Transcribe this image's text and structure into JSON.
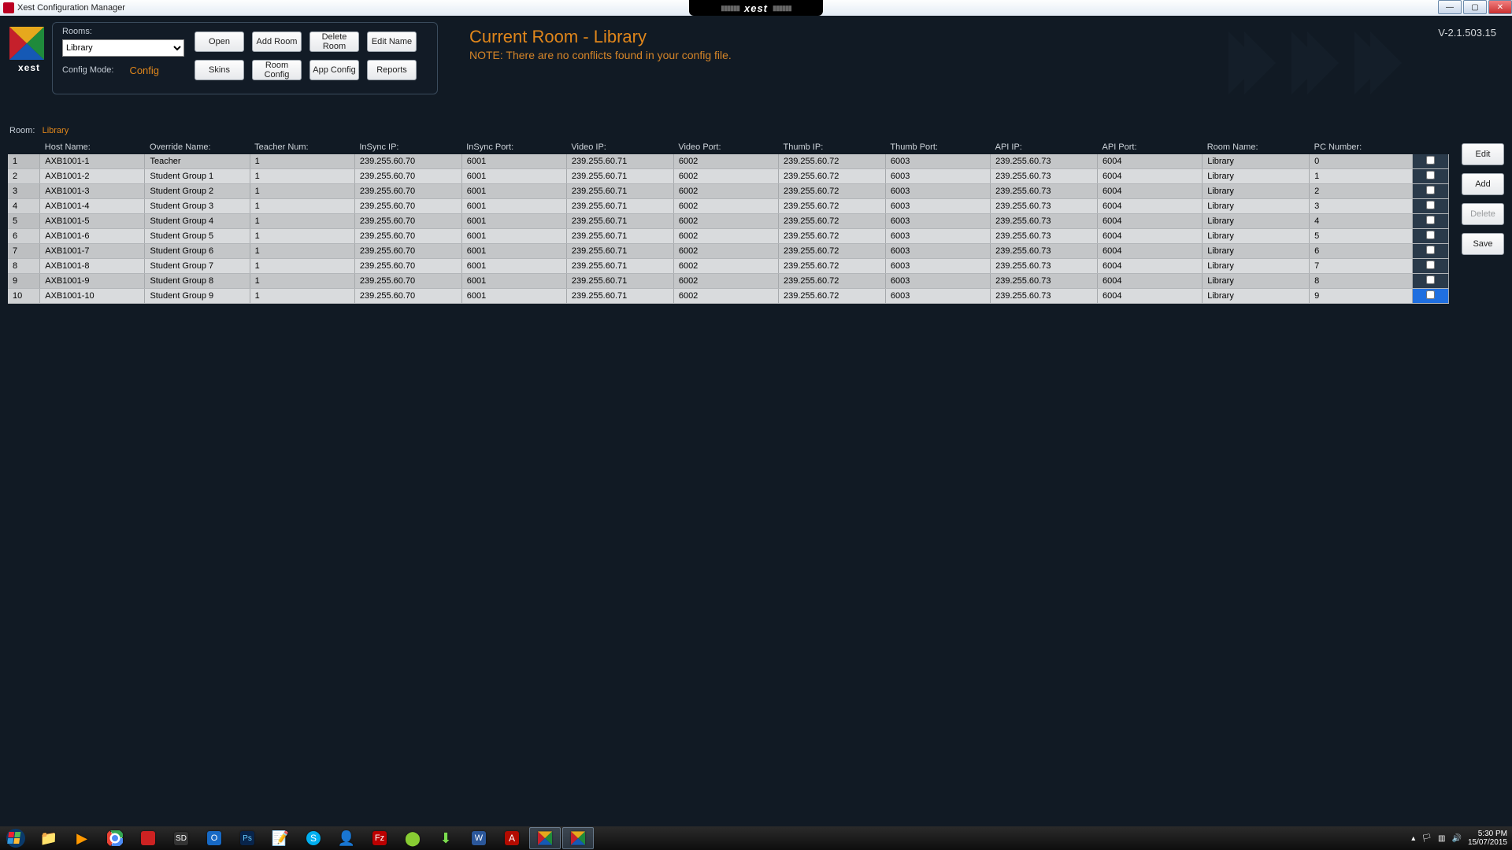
{
  "window": {
    "title": "Xest Configuration Manager",
    "center_brand": "xest"
  },
  "version": "V-2.1.503.15",
  "panel": {
    "rooms_label": "Rooms:",
    "room_selected": "Library",
    "config_mode_label": "Config Mode:",
    "config_mode_value": "Config",
    "buttons": {
      "open": "Open",
      "add_room": "Add Room",
      "delete_room": "Delete Room",
      "edit_name": "Edit Name",
      "skins": "Skins",
      "room_config": "Room Config",
      "app_config": "App Config",
      "reports": "Reports"
    }
  },
  "headline": {
    "title": "Current Room - Library",
    "note": "NOTE: There are no conflicts found in your config file."
  },
  "room_line": {
    "label": "Room:",
    "value": "Library"
  },
  "columns": {
    "host": "Host Name:",
    "override": "Override Name:",
    "teacher_num": "Teacher Num:",
    "insync_ip": "InSync IP:",
    "insync_port": "InSync Port:",
    "video_ip": "Video IP:",
    "video_port": "Video Port:",
    "thumb_ip": "Thumb IP:",
    "thumb_port": "Thumb Port:",
    "api_ip": "API IP:",
    "api_port": "API Port:",
    "room_name": "Room Name:",
    "pc_number": "PC Number:"
  },
  "rows": [
    {
      "n": "1",
      "host": "AXB1001-1",
      "override": "Teacher",
      "tn": "1",
      "iip": "239.255.60.70",
      "iport": "6001",
      "vip": "239.255.60.71",
      "vport": "6002",
      "tip": "239.255.60.72",
      "tport": "6003",
      "aip": "239.255.60.73",
      "aport": "6004",
      "room": "Library",
      "pc": "0"
    },
    {
      "n": "2",
      "host": "AXB1001-2",
      "override": "Student Group 1",
      "tn": "1",
      "iip": "239.255.60.70",
      "iport": "6001",
      "vip": "239.255.60.71",
      "vport": "6002",
      "tip": "239.255.60.72",
      "tport": "6003",
      "aip": "239.255.60.73",
      "aport": "6004",
      "room": "Library",
      "pc": "1"
    },
    {
      "n": "3",
      "host": "AXB1001-3",
      "override": "Student Group 2",
      "tn": "1",
      "iip": "239.255.60.70",
      "iport": "6001",
      "vip": "239.255.60.71",
      "vport": "6002",
      "tip": "239.255.60.72",
      "tport": "6003",
      "aip": "239.255.60.73",
      "aport": "6004",
      "room": "Library",
      "pc": "2"
    },
    {
      "n": "4",
      "host": "AXB1001-4",
      "override": "Student Group 3",
      "tn": "1",
      "iip": "239.255.60.70",
      "iport": "6001",
      "vip": "239.255.60.71",
      "vport": "6002",
      "tip": "239.255.60.72",
      "tport": "6003",
      "aip": "239.255.60.73",
      "aport": "6004",
      "room": "Library",
      "pc": "3"
    },
    {
      "n": "5",
      "host": "AXB1001-5",
      "override": "Student Group 4",
      "tn": "1",
      "iip": "239.255.60.70",
      "iport": "6001",
      "vip": "239.255.60.71",
      "vport": "6002",
      "tip": "239.255.60.72",
      "tport": "6003",
      "aip": "239.255.60.73",
      "aport": "6004",
      "room": "Library",
      "pc": "4"
    },
    {
      "n": "6",
      "host": "AXB1001-6",
      "override": "Student Group 5",
      "tn": "1",
      "iip": "239.255.60.70",
      "iport": "6001",
      "vip": "239.255.60.71",
      "vport": "6002",
      "tip": "239.255.60.72",
      "tport": "6003",
      "aip": "239.255.60.73",
      "aport": "6004",
      "room": "Library",
      "pc": "5"
    },
    {
      "n": "7",
      "host": "AXB1001-7",
      "override": "Student Group 6",
      "tn": "1",
      "iip": "239.255.60.70",
      "iport": "6001",
      "vip": "239.255.60.71",
      "vport": "6002",
      "tip": "239.255.60.72",
      "tport": "6003",
      "aip": "239.255.60.73",
      "aport": "6004",
      "room": "Library",
      "pc": "6"
    },
    {
      "n": "8",
      "host": "AXB1001-8",
      "override": "Student Group 7",
      "tn": "1",
      "iip": "239.255.60.70",
      "iport": "6001",
      "vip": "239.255.60.71",
      "vport": "6002",
      "tip": "239.255.60.72",
      "tport": "6003",
      "aip": "239.255.60.73",
      "aport": "6004",
      "room": "Library",
      "pc": "7"
    },
    {
      "n": "9",
      "host": "AXB1001-9",
      "override": "Student Group 8",
      "tn": "1",
      "iip": "239.255.60.70",
      "iport": "6001",
      "vip": "239.255.60.71",
      "vport": "6002",
      "tip": "239.255.60.72",
      "tport": "6003",
      "aip": "239.255.60.73",
      "aport": "6004",
      "room": "Library",
      "pc": "8"
    },
    {
      "n": "10",
      "host": "AXB1001-10",
      "override": "Student Group 9",
      "tn": "1",
      "iip": "239.255.60.70",
      "iport": "6001",
      "vip": "239.255.60.71",
      "vport": "6002",
      "tip": "239.255.60.72",
      "tport": "6003",
      "aip": "239.255.60.73",
      "aport": "6004",
      "room": "Library",
      "pc": "9"
    }
  ],
  "selected_row_index": 9,
  "side_buttons": {
    "edit": "Edit",
    "add": "Add",
    "delete": "Delete",
    "save": "Save"
  },
  "tray": {
    "time": "5:30 PM",
    "date": "15/07/2015"
  }
}
